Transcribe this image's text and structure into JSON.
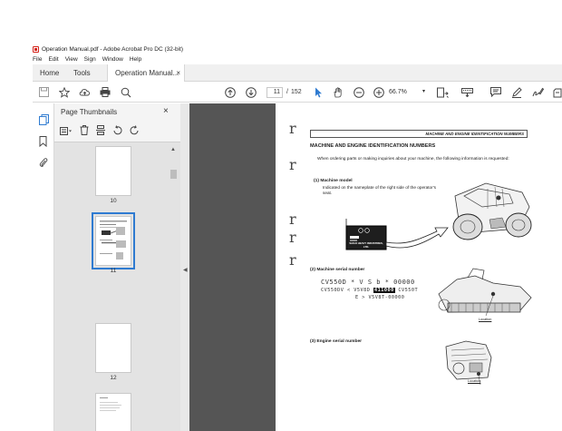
{
  "window": {
    "title": "Operation Manual.pdf - Adobe Acrobat Pro DC (32-bit)"
  },
  "menu": [
    "File",
    "Edit",
    "View",
    "Sign",
    "Window",
    "Help"
  ],
  "tabs": {
    "home": "Home",
    "tools": "Tools",
    "document": "Operation Manual...",
    "close_glyph": "×"
  },
  "toolbar": {
    "current_page": "11",
    "page_separator": "/",
    "total_pages": "152",
    "zoom": "66.7%"
  },
  "icons": {
    "save": "save-icon",
    "bookmark": "star-icon",
    "upload": "cloud-upload-icon",
    "print": "print-icon",
    "search": "search-icon",
    "prev": "arrow-up-circle-icon",
    "next": "arrow-down-circle-icon",
    "select": "cursor-icon",
    "hand": "hand-icon",
    "zoom_out": "zoom-out-icon",
    "zoom_in": "zoom-in-icon"
  },
  "panel": {
    "title": "Page Thumbnails",
    "close_glyph": "×",
    "thumbnails": [
      {
        "page": "10",
        "selected": false
      },
      {
        "page": "11",
        "selected": true
      },
      {
        "page": "12",
        "selected": false
      },
      {
        "page": "13",
        "selected": false
      }
    ]
  },
  "document": {
    "header": "MACHINE AND ENGINE IDENTIFICATION NUMBERS",
    "heading": "MACHINE AND ENGINE IDENTIFICATION NUMBERS",
    "intro": "When ordering parts or making inquiries about your machine, the following information is requested:",
    "section1_title": "(1) Machine model",
    "section1_body": "Indicated on the nameplate of the right side of the operator's seat.",
    "section2_title": "(2) Machine serial number",
    "serial_line1": "CV550D * V S b * 00000",
    "serial_line2_a": "CV550DV < V5V8D",
    "serial_highlight": "411000",
    "serial_line2_b": "CV550T",
    "serial_line3": "E > V5V8T-00000",
    "section3_title": "(3) Engine serial number",
    "location_label": "Location",
    "plate_text": "SAKAI HEAVY INDUSTRIES, LTD.",
    "margin_marks": [
      "r",
      "r",
      "r",
      "r",
      "r"
    ]
  },
  "colors": {
    "accent_blue": "#2f7bd1",
    "acrobat_red": "#d4231a",
    "viewer_gray": "#555555"
  }
}
